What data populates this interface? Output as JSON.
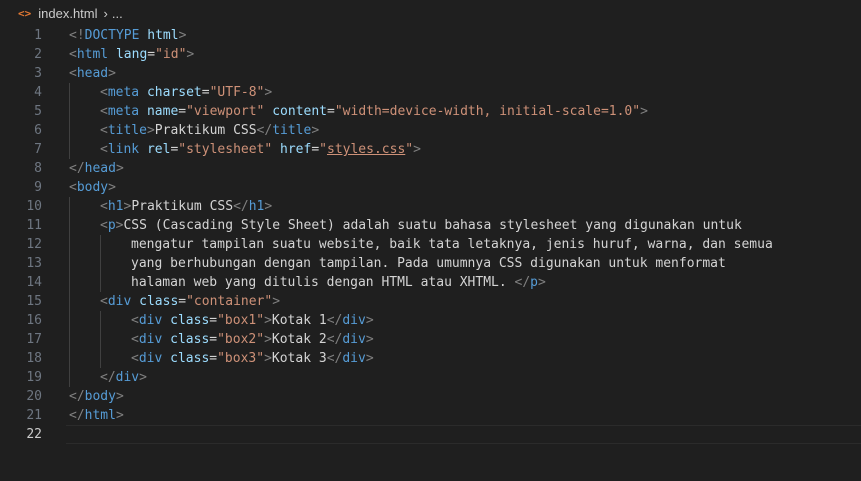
{
  "breadcrumb": {
    "icon": "html-file-icon",
    "filename": "index.html",
    "separator": "›",
    "ellipsis": "..."
  },
  "editor": {
    "current_line": 22,
    "lines": [
      {
        "n": "1",
        "indent": 0,
        "tokens": [
          {
            "t": "punct",
            "v": "<!"
          },
          {
            "t": "tag",
            "v": "DOCTYPE"
          },
          {
            "t": "text",
            "v": " "
          },
          {
            "t": "attr",
            "v": "html"
          },
          {
            "t": "punct",
            "v": ">"
          }
        ]
      },
      {
        "n": "2",
        "indent": 0,
        "tokens": [
          {
            "t": "punct",
            "v": "<"
          },
          {
            "t": "tag",
            "v": "html"
          },
          {
            "t": "text",
            "v": " "
          },
          {
            "t": "attr",
            "v": "lang"
          },
          {
            "t": "text",
            "v": "="
          },
          {
            "t": "str",
            "v": "\"id\""
          },
          {
            "t": "punct",
            "v": ">"
          }
        ]
      },
      {
        "n": "3",
        "indent": 0,
        "tokens": [
          {
            "t": "punct",
            "v": "<"
          },
          {
            "t": "tag",
            "v": "head"
          },
          {
            "t": "punct",
            "v": ">"
          }
        ]
      },
      {
        "n": "4",
        "indent": 1,
        "tokens": [
          {
            "t": "punct",
            "v": "<"
          },
          {
            "t": "tag",
            "v": "meta"
          },
          {
            "t": "text",
            "v": " "
          },
          {
            "t": "attr",
            "v": "charset"
          },
          {
            "t": "text",
            "v": "="
          },
          {
            "t": "str",
            "v": "\"UTF-8\""
          },
          {
            "t": "punct",
            "v": ">"
          }
        ]
      },
      {
        "n": "5",
        "indent": 1,
        "tokens": [
          {
            "t": "punct",
            "v": "<"
          },
          {
            "t": "tag",
            "v": "meta"
          },
          {
            "t": "text",
            "v": " "
          },
          {
            "t": "attr",
            "v": "name"
          },
          {
            "t": "text",
            "v": "="
          },
          {
            "t": "str",
            "v": "\"viewport\""
          },
          {
            "t": "text",
            "v": " "
          },
          {
            "t": "attr",
            "v": "content"
          },
          {
            "t": "text",
            "v": "="
          },
          {
            "t": "str",
            "v": "\"width=device-width, initial-scale=1.0\""
          },
          {
            "t": "punct",
            "v": ">"
          }
        ]
      },
      {
        "n": "6",
        "indent": 1,
        "tokens": [
          {
            "t": "punct",
            "v": "<"
          },
          {
            "t": "tag",
            "v": "title"
          },
          {
            "t": "punct",
            "v": ">"
          },
          {
            "t": "text",
            "v": "Praktikum CSS"
          },
          {
            "t": "punct",
            "v": "</"
          },
          {
            "t": "tag",
            "v": "title"
          },
          {
            "t": "punct",
            "v": ">"
          }
        ]
      },
      {
        "n": "7",
        "indent": 1,
        "tokens": [
          {
            "t": "punct",
            "v": "<"
          },
          {
            "t": "tag",
            "v": "link"
          },
          {
            "t": "text",
            "v": " "
          },
          {
            "t": "attr",
            "v": "rel"
          },
          {
            "t": "text",
            "v": "="
          },
          {
            "t": "str",
            "v": "\"stylesheet\""
          },
          {
            "t": "text",
            "v": " "
          },
          {
            "t": "attr",
            "v": "href"
          },
          {
            "t": "text",
            "v": "="
          },
          {
            "t": "str",
            "v": "\""
          },
          {
            "t": "link",
            "v": "styles.css"
          },
          {
            "t": "str",
            "v": "\""
          },
          {
            "t": "punct",
            "v": ">"
          }
        ]
      },
      {
        "n": "8",
        "indent": 0,
        "tokens": [
          {
            "t": "punct",
            "v": "</"
          },
          {
            "t": "tag",
            "v": "head"
          },
          {
            "t": "punct",
            "v": ">"
          }
        ]
      },
      {
        "n": "9",
        "indent": 0,
        "tokens": [
          {
            "t": "punct",
            "v": "<"
          },
          {
            "t": "tag",
            "v": "body"
          },
          {
            "t": "punct",
            "v": ">"
          }
        ]
      },
      {
        "n": "10",
        "indent": 1,
        "tokens": [
          {
            "t": "punct",
            "v": "<"
          },
          {
            "t": "tag",
            "v": "h1"
          },
          {
            "t": "punct",
            "v": ">"
          },
          {
            "t": "text",
            "v": "Praktikum CSS"
          },
          {
            "t": "punct",
            "v": "</"
          },
          {
            "t": "tag",
            "v": "h1"
          },
          {
            "t": "punct",
            "v": ">"
          }
        ]
      },
      {
        "n": "11",
        "indent": 1,
        "tokens": [
          {
            "t": "punct",
            "v": "<"
          },
          {
            "t": "tag",
            "v": "p"
          },
          {
            "t": "punct",
            "v": ">"
          },
          {
            "t": "text",
            "v": "CSS (Cascading Style Sheet) adalah suatu bahasa stylesheet yang digunakan untuk"
          }
        ]
      },
      {
        "n": "12",
        "indent": 2,
        "tokens": [
          {
            "t": "text",
            "v": "mengatur tampilan suatu website, baik tata letaknya, jenis huruf, warna, dan semua"
          }
        ]
      },
      {
        "n": "13",
        "indent": 2,
        "tokens": [
          {
            "t": "text",
            "v": "yang berhubungan dengan tampilan. Pada umumnya CSS digunakan untuk menformat"
          }
        ]
      },
      {
        "n": "14",
        "indent": 2,
        "tokens": [
          {
            "t": "text",
            "v": "halaman web yang ditulis dengan HTML atau XHTML. "
          },
          {
            "t": "punct",
            "v": "</"
          },
          {
            "t": "tag",
            "v": "p"
          },
          {
            "t": "punct",
            "v": ">"
          }
        ]
      },
      {
        "n": "15",
        "indent": 1,
        "tokens": [
          {
            "t": "punct",
            "v": "<"
          },
          {
            "t": "tag",
            "v": "div"
          },
          {
            "t": "text",
            "v": " "
          },
          {
            "t": "attr",
            "v": "class"
          },
          {
            "t": "text",
            "v": "="
          },
          {
            "t": "str",
            "v": "\"container\""
          },
          {
            "t": "punct",
            "v": ">"
          }
        ]
      },
      {
        "n": "16",
        "indent": 2,
        "tokens": [
          {
            "t": "punct",
            "v": "<"
          },
          {
            "t": "tag",
            "v": "div"
          },
          {
            "t": "text",
            "v": " "
          },
          {
            "t": "attr",
            "v": "class"
          },
          {
            "t": "text",
            "v": "="
          },
          {
            "t": "str",
            "v": "\"box1\""
          },
          {
            "t": "punct",
            "v": ">"
          },
          {
            "t": "text",
            "v": "Kotak 1"
          },
          {
            "t": "punct",
            "v": "</"
          },
          {
            "t": "tag",
            "v": "div"
          },
          {
            "t": "punct",
            "v": ">"
          }
        ]
      },
      {
        "n": "17",
        "indent": 2,
        "tokens": [
          {
            "t": "punct",
            "v": "<"
          },
          {
            "t": "tag",
            "v": "div"
          },
          {
            "t": "text",
            "v": " "
          },
          {
            "t": "attr",
            "v": "class"
          },
          {
            "t": "text",
            "v": "="
          },
          {
            "t": "str",
            "v": "\"box2\""
          },
          {
            "t": "punct",
            "v": ">"
          },
          {
            "t": "text",
            "v": "Kotak 2"
          },
          {
            "t": "punct",
            "v": "</"
          },
          {
            "t": "tag",
            "v": "div"
          },
          {
            "t": "punct",
            "v": ">"
          }
        ]
      },
      {
        "n": "18",
        "indent": 2,
        "tokens": [
          {
            "t": "punct",
            "v": "<"
          },
          {
            "t": "tag",
            "v": "div"
          },
          {
            "t": "text",
            "v": " "
          },
          {
            "t": "attr",
            "v": "class"
          },
          {
            "t": "text",
            "v": "="
          },
          {
            "t": "str",
            "v": "\"box3\""
          },
          {
            "t": "punct",
            "v": ">"
          },
          {
            "t": "text",
            "v": "Kotak 3"
          },
          {
            "t": "punct",
            "v": "</"
          },
          {
            "t": "tag",
            "v": "div"
          },
          {
            "t": "punct",
            "v": ">"
          }
        ]
      },
      {
        "n": "19",
        "indent": 1,
        "tokens": [
          {
            "t": "punct",
            "v": "</"
          },
          {
            "t": "tag",
            "v": "div"
          },
          {
            "t": "punct",
            "v": ">"
          }
        ]
      },
      {
        "n": "20",
        "indent": 0,
        "tokens": [
          {
            "t": "punct",
            "v": "</"
          },
          {
            "t": "tag",
            "v": "body"
          },
          {
            "t": "punct",
            "v": ">"
          }
        ]
      },
      {
        "n": "21",
        "indent": 0,
        "tokens": [
          {
            "t": "punct",
            "v": "</"
          },
          {
            "t": "tag",
            "v": "html"
          },
          {
            "t": "punct",
            "v": ">"
          }
        ]
      },
      {
        "n": "22",
        "indent": 0,
        "tokens": []
      }
    ]
  },
  "colors": {
    "background": "#1f1f1f",
    "tag": "#569cd6",
    "attribute": "#9cdcfe",
    "string": "#ce9178",
    "text": "#d4d4d4",
    "punctuation": "#808080",
    "line_number": "#6e7681"
  }
}
